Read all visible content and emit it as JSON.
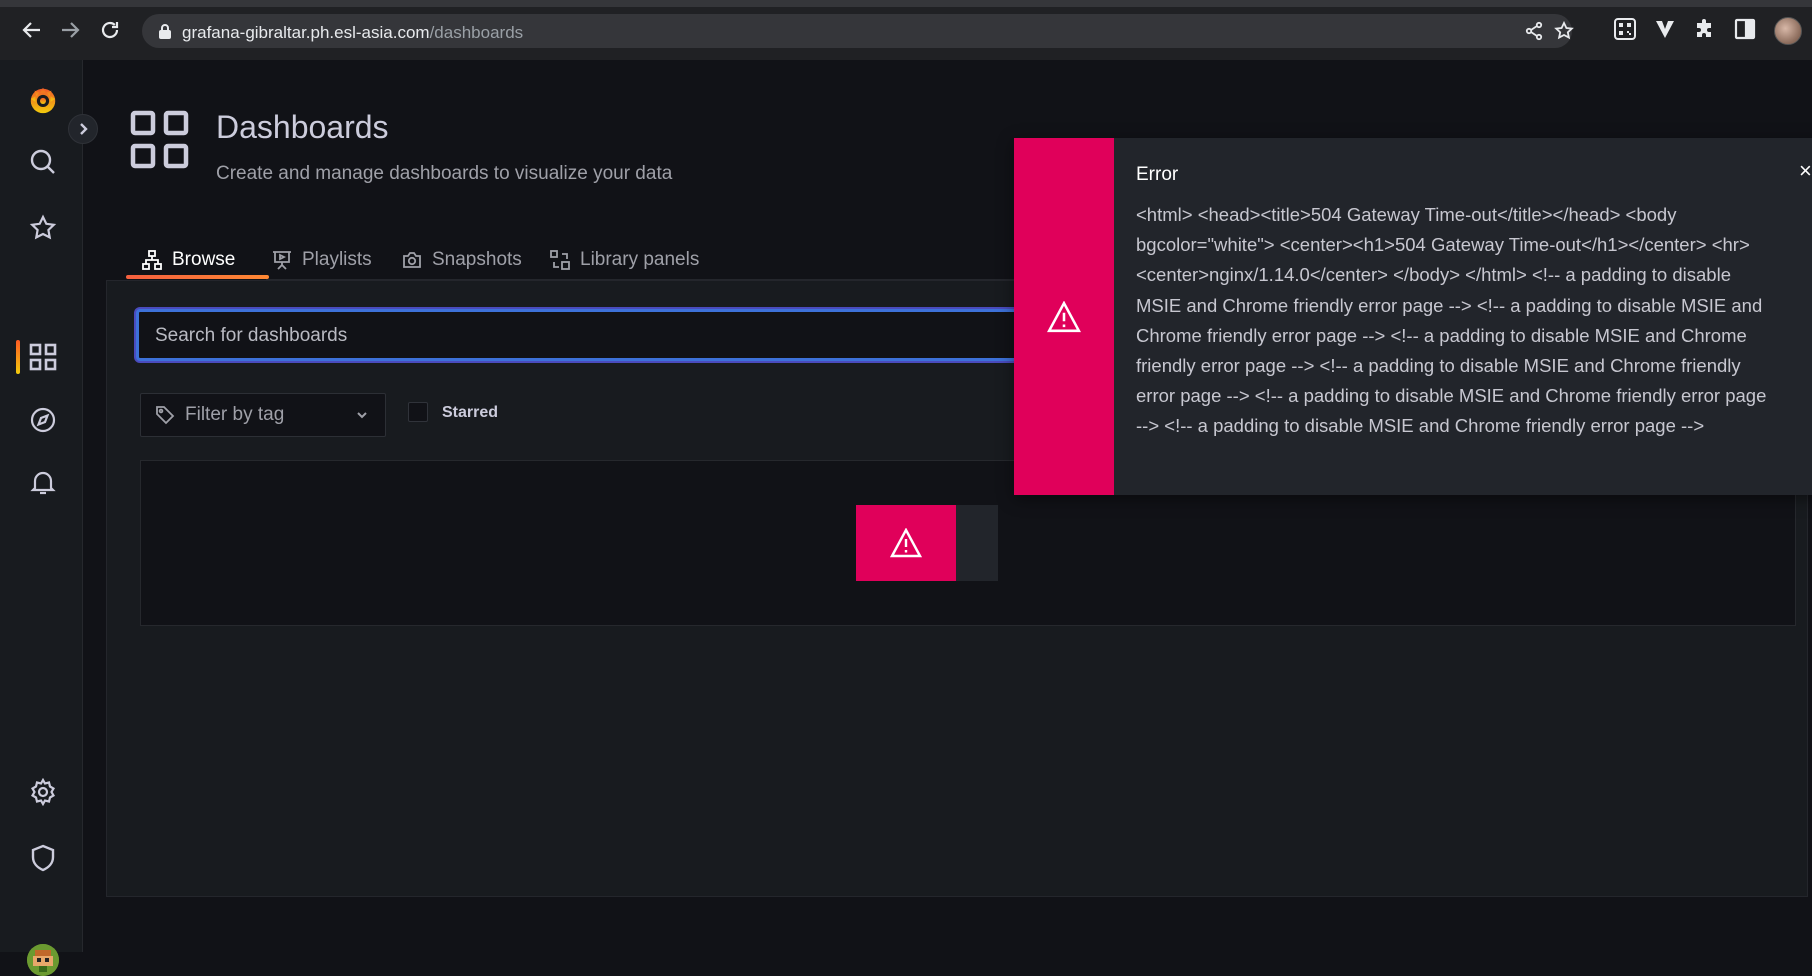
{
  "browser": {
    "url_host": "grafana-gibraltar.ph.esl-asia.com",
    "url_path": "/dashboards"
  },
  "page": {
    "title": "Dashboards",
    "subtitle": "Create and manage dashboards to visualize your data"
  },
  "tabs": [
    {
      "label": "Browse",
      "icon": "sitemap-icon",
      "active": true
    },
    {
      "label": "Playlists",
      "icon": "presentation-icon",
      "active": false
    },
    {
      "label": "Snapshots",
      "icon": "camera-icon",
      "active": false
    },
    {
      "label": "Library panels",
      "icon": "library-panels-icon",
      "active": false
    }
  ],
  "search": {
    "placeholder": "Search for dashboards",
    "value": ""
  },
  "filter": {
    "label": "Filter by tag"
  },
  "starred": {
    "label": "Starred",
    "checked": false
  },
  "error_toast": {
    "title": "Error",
    "close": "×",
    "message": "<html> <head><title>504 Gateway Time-out</title></head> <body bgcolor=\"white\"> <center><h1>504 Gateway Time-out</h1></center> <hr><center>nginx/1.14.0</center> </body> </html> <!-- a padding to disable MSIE and Chrome friendly error page --> <!-- a padding to disable MSIE and Chrome friendly error page --> <!-- a padding to disable MSIE and Chrome friendly error page --> <!-- a padding to disable MSIE and Chrome friendly error page --> <!-- a padding to disable MSIE and Chrome friendly error page --> <!-- a padding to disable MSIE and Chrome friendly error page -->"
  },
  "colors": {
    "error_red": "#e0005a",
    "accent_orange": "#ff5a24",
    "search_border": "#3d71d9",
    "background": "#111217"
  }
}
